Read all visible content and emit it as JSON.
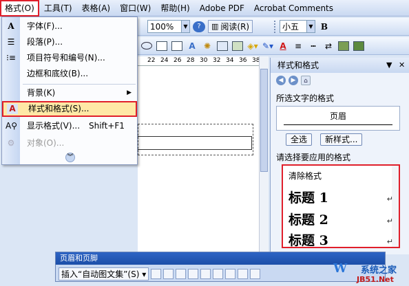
{
  "menubar": {
    "items": [
      "格式(O)",
      "工具(T)",
      "表格(A)",
      "窗口(W)",
      "帮助(H)",
      "Adobe PDF",
      "Acrobat Comments"
    ]
  },
  "toolbar": {
    "zoom": "100%",
    "read_label": "阅读(R)",
    "font_size": "小五",
    "bold": "B",
    "font_color_glyph": "A"
  },
  "ruler": {
    "ticks": [
      "22",
      "24",
      "26",
      "28",
      "30",
      "32",
      "34",
      "36",
      "38"
    ]
  },
  "format_menu": {
    "items": [
      {
        "label": "字体(F)...",
        "icon": "font-icon"
      },
      {
        "label": "段落(P)...",
        "icon": "paragraph-icon"
      },
      {
        "label": "项目符号和编号(N)...",
        "icon": "bullets-icon"
      },
      {
        "label": "边框和底纹(B)...",
        "icon": ""
      },
      {
        "label": "背景(K)",
        "icon": "",
        "submenu": true
      },
      {
        "label": "样式和格式(S)...",
        "icon": "styles-formatting-icon",
        "highlighted": true
      },
      {
        "label": "显示格式(V)...",
        "shortcut": "Shift+F1",
        "icon": "reveal-formatting-icon"
      },
      {
        "label": "对象(O)...",
        "icon": "object-icon",
        "disabled": true
      }
    ]
  },
  "task_pane": {
    "title": "样式和格式",
    "selected_text_format_label": "所选文字的格式",
    "current_format": "页眉",
    "select_all_button": "全选",
    "new_style_button": "新样式...",
    "apply_label": "请选择要应用的格式",
    "styles": [
      {
        "name": "清除格式",
        "kind": "clear"
      },
      {
        "name": "标题 1",
        "kind": "heading"
      },
      {
        "name": "标题 2",
        "kind": "heading"
      },
      {
        "name": "标题 3",
        "kind": "heading"
      }
    ],
    "return_mark": "↵"
  },
  "header_footer_toolbar": {
    "title": "页眉和页脚",
    "insert_autotext": "插入“自动图文集”(S)"
  },
  "watermark": {
    "brand": "W",
    "text": "系统之家",
    "site": "JB51.Net"
  },
  "colors": {
    "highlight_border": "#e01e2a",
    "menu_highlight": "#ffe8a6",
    "titlebar_blue": "#1c4ea8"
  }
}
